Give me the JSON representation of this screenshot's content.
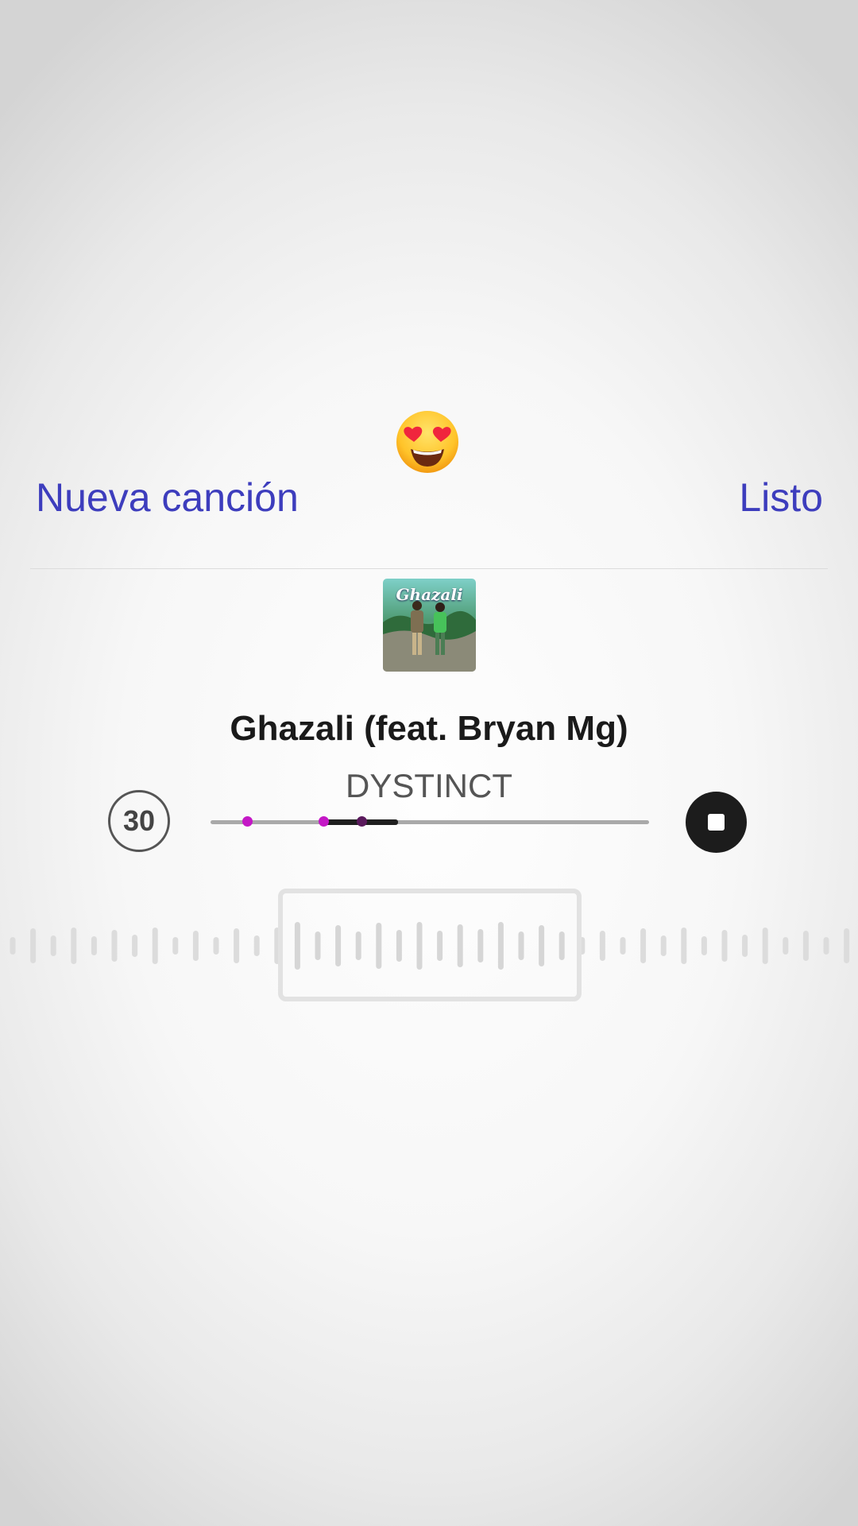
{
  "sticker": {
    "icon": "heart-eyes-emoji-icon"
  },
  "header": {
    "new_song_label": "Nueva canción",
    "done_label": "Listo"
  },
  "track": {
    "title": "Ghazali (feat. Bryan Mg)",
    "artist": "DYSTINCT",
    "album_icon": "album-cover-art",
    "album_art_text": "Ghazali"
  },
  "clip": {
    "duration_label": "30",
    "selection_start_fraction": 0.26,
    "selection_end_fraction": 0.43
  },
  "player": {
    "stop_icon": "stop-icon"
  },
  "colors": {
    "accent": "#3d3dbd",
    "marker": "#c418c6",
    "text": "#1a1a1a"
  }
}
